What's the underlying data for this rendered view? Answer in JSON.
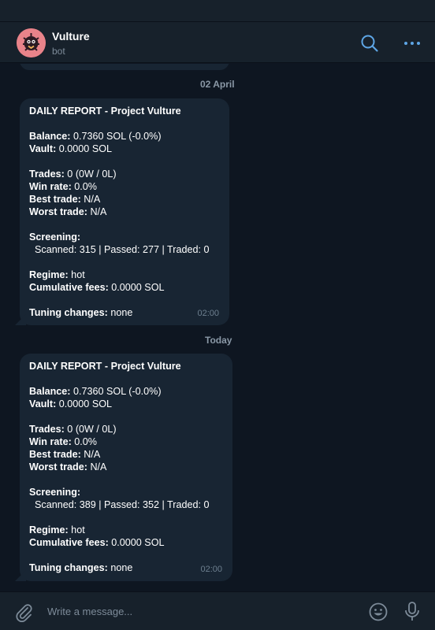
{
  "header": {
    "chat_name": "Vulture",
    "chat_status": "bot",
    "icons": [
      "search-icon",
      "more-icon"
    ]
  },
  "messages": {
    "dates": [
      "02 April",
      "Today"
    ],
    "reports": [
      {
        "title": "DAILY REPORT - Project Vulture",
        "balance_label": "Balance:",
        "balance_value": " 0.7360 SOL (-0.0%)",
        "vault_label": "Vault:",
        "vault_value": " 0.0000 SOL",
        "trades_label": "Trades:",
        "trades_value": " 0 (0W / 0L)",
        "winrate_label": "Win rate:",
        "winrate_value": " 0.0%",
        "best_label": "Best trade:",
        "best_value": " N/A",
        "worst_label": "Worst trade:",
        "worst_value": " N/A",
        "screening_label": "Screening:",
        "screening_value": "  Scanned: 315 | Passed: 277 | Traded: 0",
        "regime_label": "Regime:",
        "regime_value": " hot",
        "fees_label": "Cumulative fees:",
        "fees_value": " 0.0000 SOL",
        "tuning_label": "Tuning changes:",
        "tuning_value": " none",
        "time": "02:00"
      },
      {
        "title": "DAILY REPORT - Project Vulture",
        "balance_label": "Balance:",
        "balance_value": " 0.7360 SOL (-0.0%)",
        "vault_label": "Vault:",
        "vault_value": " 0.0000 SOL",
        "trades_label": "Trades:",
        "trades_value": " 0 (0W / 0L)",
        "winrate_label": "Win rate:",
        "winrate_value": " 0.0%",
        "best_label": "Best trade:",
        "best_value": " N/A",
        "worst_label": "Worst trade:",
        "worst_value": " N/A",
        "screening_label": "Screening:",
        "screening_value": "  Scanned: 389 | Passed: 352 | Traded: 0",
        "regime_label": "Regime:",
        "regime_value": " hot",
        "fees_label": "Cumulative fees:",
        "fees_value": " 0.0000 SOL",
        "tuning_label": "Tuning changes:",
        "tuning_value": " none",
        "time": "02:00"
      }
    ]
  },
  "composer": {
    "placeholder": "Write a message...",
    "icons": [
      "attach-icon",
      "emoji-icon",
      "microphone-icon"
    ]
  },
  "colors": {
    "background": "#0e1621",
    "panel": "#17212b",
    "bubble": "#182533",
    "accent": "#5ea6e6",
    "muted": "#7d8b99"
  }
}
